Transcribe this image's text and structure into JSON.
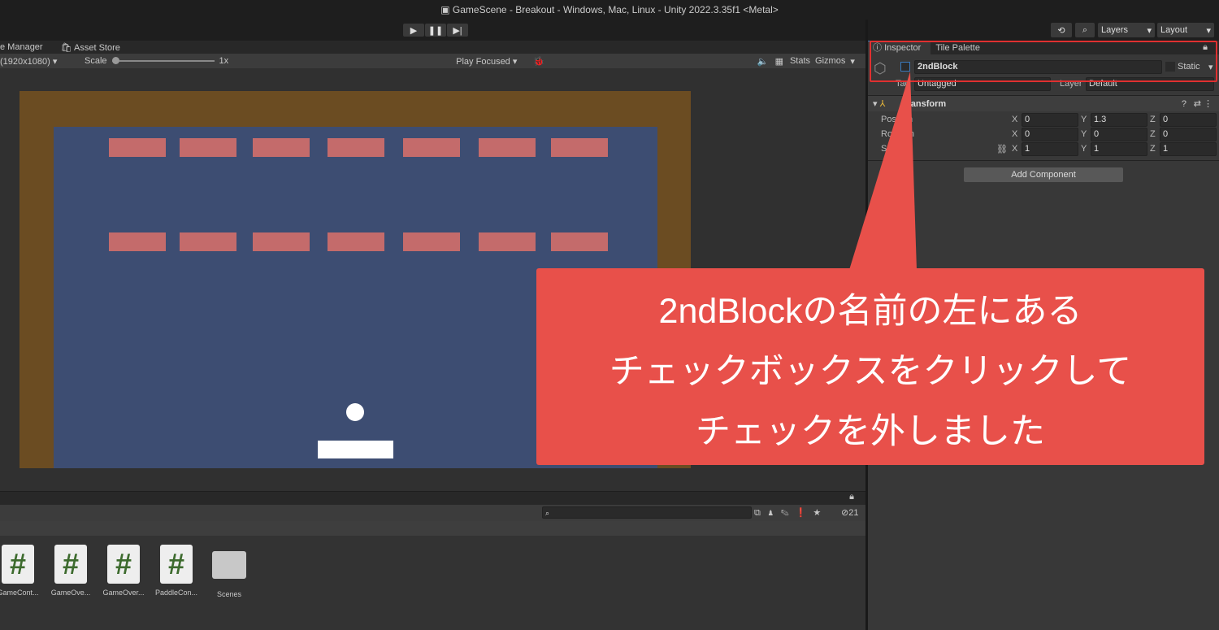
{
  "window": {
    "title": "GameScene - Breakout - Windows, Mac, Linux - Unity 2022.3.35f1 <Metal>"
  },
  "toolbar": {
    "layers": "Layers",
    "layout": "Layout"
  },
  "tabs": {
    "package_manager": "e Manager",
    "asset_store": "Asset Store"
  },
  "game": {
    "resolution": "(1920x1080)",
    "scale_label": "Scale",
    "scale_value": "1x",
    "play_mode": "Play Focused",
    "stats": "Stats",
    "gizmos": "Gizmos"
  },
  "inspector": {
    "tab_inspector": "Inspector",
    "tab_tile": "Tile Palette",
    "object_name": "2ndBlock",
    "active": false,
    "static": "Static",
    "tag_label": "Tag",
    "tag_value": "Untagged",
    "layer_label": "Layer",
    "layer_value": "Default",
    "component": "Transform",
    "rows": [
      {
        "label": "Position",
        "x": "0",
        "y": "1.3",
        "z": "0"
      },
      {
        "label": "Rotation",
        "x": "0",
        "y": "0",
        "z": "0"
      },
      {
        "label": "Scale",
        "x": "1",
        "y": "1",
        "z": "1"
      }
    ],
    "add_component": "Add Component"
  },
  "project": {
    "hidden_count": "21",
    "assets": [
      {
        "name": "GameCont...",
        "type": "script"
      },
      {
        "name": "GameOve...",
        "type": "script"
      },
      {
        "name": "GameOver...",
        "type": "script"
      },
      {
        "name": "PaddleCon...",
        "type": "script"
      },
      {
        "name": "Scenes",
        "type": "folder"
      }
    ]
  },
  "callout": {
    "lines": [
      "2ndBlockの名前の左にある",
      "チェックボックスをクリックして",
      "チェックを外しました"
    ],
    "color": "#e8504a"
  },
  "colors": {
    "border": "#6b4c22",
    "field": "#3d4d72",
    "brick": "#c46b6b"
  }
}
